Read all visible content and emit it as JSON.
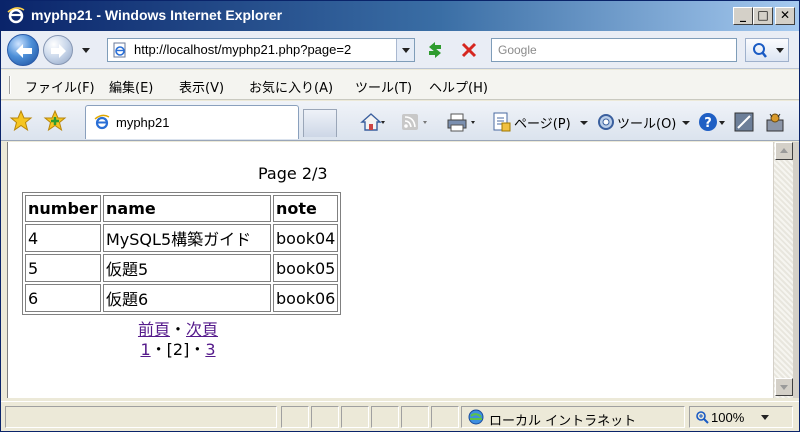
{
  "window": {
    "title": "myphp21 - Windows Internet Explorer",
    "minimize": "_",
    "maximize": "□",
    "close": "✕"
  },
  "address": {
    "url": "http://localhost/myphp21.php?page=2",
    "search_placeholder": "Google"
  },
  "menu": {
    "items": [
      "ファイル(F)",
      "編集(E)",
      "表示(V)",
      "お気に入り(A)",
      "ツール(T)",
      "ヘルプ(H)"
    ]
  },
  "tabs": {
    "active_label": "myphp21"
  },
  "command_bar": {
    "page_label": "ページ(P)",
    "tools_label": "ツール(O)"
  },
  "content": {
    "page_info": "Page 2/3",
    "table": {
      "headers": [
        "number",
        "name",
        "note"
      ],
      "rows": [
        [
          "4",
          "MySQL5構築ガイド",
          "book04"
        ],
        [
          "5",
          "仮題5",
          "book05"
        ],
        [
          "6",
          "仮題6",
          "book06"
        ]
      ]
    },
    "pager": {
      "prev": "前頁",
      "dot": "・",
      "next": "次頁",
      "page1": "1",
      "page2": "[2]",
      "page3": "3"
    }
  },
  "status": {
    "zone": "ローカル イントラネット",
    "zoom": "100%"
  },
  "colors": {
    "title_bar": "#0a246a",
    "link_visited": "#551a8b"
  },
  "icons": [
    "ie-logo-icon",
    "back-arrow-icon",
    "forward-arrow-icon",
    "refresh-icon",
    "stop-icon",
    "search-icon",
    "favorites-star-icon",
    "add-favorites-icon",
    "home-icon",
    "feeds-icon",
    "print-icon",
    "page-icon",
    "tools-gear-icon",
    "help-icon",
    "research-icon",
    "intranet-icon",
    "zoom-icon"
  ]
}
